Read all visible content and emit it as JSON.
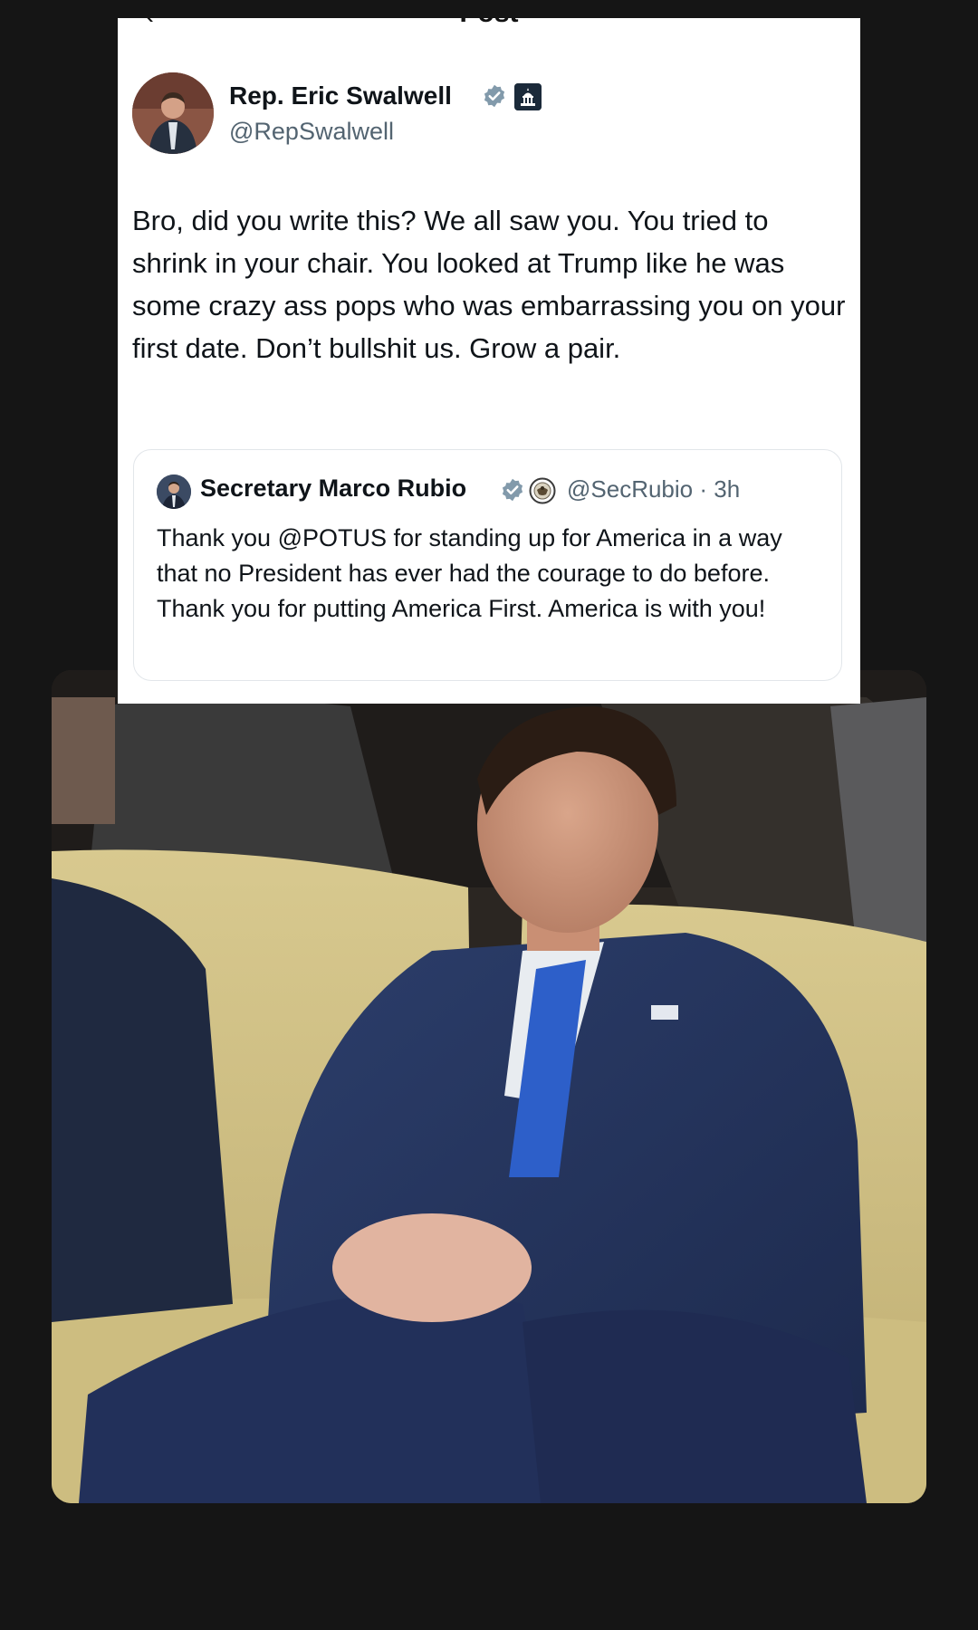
{
  "header": {
    "back_icon": "back-arrow-icon",
    "title": "Post"
  },
  "post": {
    "author_name": "Rep. Eric Swalwell",
    "author_handle": "@RepSwalwell",
    "badges": [
      "verified-badge-icon",
      "government-capitol-badge-icon"
    ],
    "text": "Bro, did you write this? We all saw you. You tried to shrink in your chair. You looked at Trump like he was some crazy ass pops who was embarrassing you on your first date. Don’t bullshit us. Grow a pair."
  },
  "quoted_post": {
    "author_name": "Secretary Marco Rubio",
    "author_handle": "@SecRubio",
    "separator": "·",
    "time": "3h",
    "badges": [
      "verified-badge-icon",
      "state-department-seal-icon"
    ],
    "text": "Thank you @POTUS for standing up for America in a way that no President has ever had the courage to do before. Thank you for putting America First. America is with you!"
  },
  "photo": {
    "description_icon": "seated-man-photo"
  },
  "colors": {
    "background": "#151515",
    "card": "#ffffff",
    "text": "#0f1419",
    "secondary_text": "#536471",
    "verified": "#829aab"
  }
}
